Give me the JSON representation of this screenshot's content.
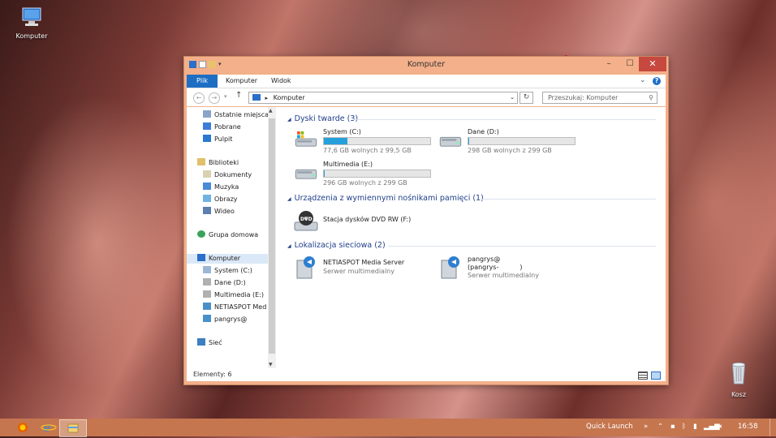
{
  "desktop": {
    "computer_icon_label": "Komputer",
    "recycle_icon_label": "Kosz"
  },
  "window": {
    "title": "Komputer",
    "minimize": "–",
    "maximize": "☐",
    "close": "✕"
  },
  "ribbon": {
    "tabs": [
      "Plik",
      "Komputer",
      "Widok"
    ],
    "help": "?"
  },
  "address": {
    "path": "Komputer",
    "search_placeholder": "Przeszukaj: Komputer"
  },
  "nav": {
    "favorites": [
      "Ostatnie miejsca",
      "Pobrane",
      "Pulpit"
    ],
    "libraries_header": "Biblioteki",
    "libraries": [
      "Dokumenty",
      "Muzyka",
      "Obrazy",
      "Wideo"
    ],
    "homegroup": "Grupa domowa",
    "computer_header": "Komputer",
    "computer_items": [
      "System (C:)",
      "Dane (D:)",
      "Multimedia (E:)",
      "NETIASPOT Med",
      "pangrys@"
    ],
    "network": "Sieć"
  },
  "groups": {
    "hard_drives": "Dyski twarde (3)",
    "removable": "Urządzenia z wymiennymi nośnikami pamięci (1)",
    "network_locations": "Lokalizacja sieciowa (2)"
  },
  "drives": [
    {
      "name": "System (C:)",
      "free": "77,6 GB wolnych z 99,5 GB",
      "used_fraction": 0.22
    },
    {
      "name": "Dane (D:)",
      "free": "298 GB wolnych z 299 GB",
      "used_fraction": 0.003
    },
    {
      "name": "Multimedia (E:)",
      "free": "296 GB wolnych z 299 GB",
      "used_fraction": 0.01
    }
  ],
  "dvd": {
    "name": "Stacja dysków DVD RW (F:)",
    "badge": "DVD"
  },
  "network_items": [
    {
      "name": "NETIASPOT Media Server",
      "sub": "Serwer multimedialny"
    },
    {
      "name": "pangrys@",
      "name2": "(pangrys-",
      "name3": ")",
      "sub": "Serwer multimedialny"
    }
  ],
  "status": {
    "items_count": "Elementy: 6"
  },
  "taskbar": {
    "quick_launch": "Quick Launch",
    "chevron": "»",
    "clock": "16:58"
  },
  "colors": {
    "accent": "#1e6fc4",
    "taskbar": "#c5764f",
    "progress": "#26a0da"
  }
}
